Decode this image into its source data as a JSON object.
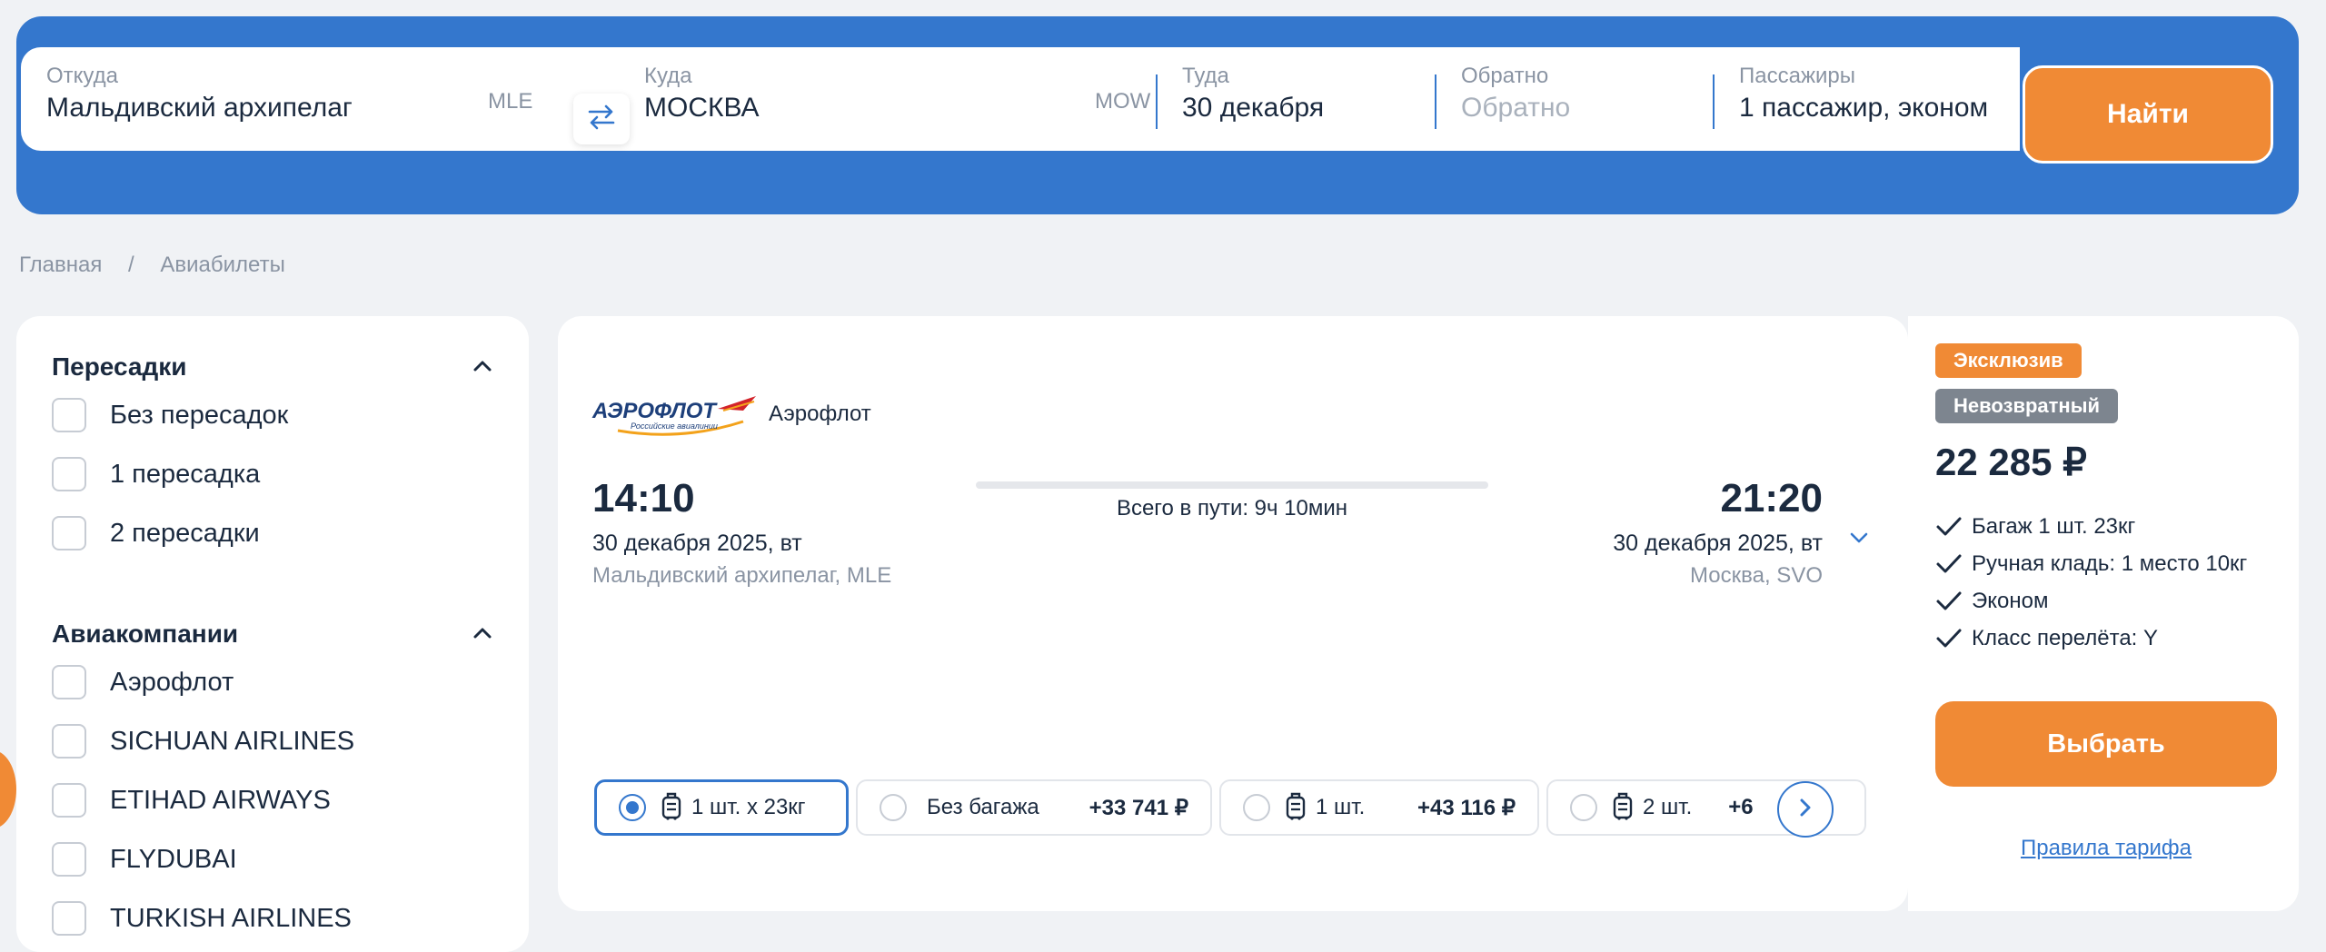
{
  "search": {
    "from_label": "Откуда",
    "from_value": "Мальдивский архипелаг",
    "from_code": "MLE",
    "to_label": "Куда",
    "to_value": "МОСКВА",
    "to_code": "MOW",
    "depart_label": "Туда",
    "depart_value": "30 декабря",
    "return_label": "Обратно",
    "return_placeholder": "Обратно",
    "passengers_label": "Пассажиры",
    "passengers_value": "1 пассажир, эконом",
    "find_button": "Найти",
    "swap_icon": "swap-arrows-icon"
  },
  "breadcrumb": {
    "home": "Главная",
    "separator": "/",
    "current": "Авиабилеты"
  },
  "filters": {
    "transfers_title": "Пересадки",
    "transfers": [
      "Без пересадок",
      "1 пересадка",
      "2 пересадки"
    ],
    "airlines_title": "Авиакомпании",
    "airlines": [
      "Аэрофлот",
      "SICHUAN AIRLINES",
      "ETIHAD AIRWAYS",
      "FLYDUBAI",
      "TURKISH AIRLINES"
    ]
  },
  "flight": {
    "airline_logo_text": "АЭРОФЛОТ",
    "airline_logo_subtext": "Российские авиалинии",
    "airline": "Аэрофлот",
    "depart_time": "14:10",
    "depart_date": "30 декабря 2025, вт",
    "depart_place": "Мальдивский архипелаг, MLE",
    "duration": "Всего в пути: 9ч 10мин",
    "arrive_time": "21:20",
    "arrive_date": "30 декабря 2025, вт",
    "arrive_place": "Москва, SVO",
    "baggage_options": [
      {
        "label": "1 шт. x 23кг",
        "price": "",
        "selected": true
      },
      {
        "label": "Без багажа",
        "price": "+33 741 ₽",
        "selected": false
      },
      {
        "label": "1 шт.",
        "price": "+43 116 ₽",
        "selected": false
      },
      {
        "label": "2 шт.",
        "price": "+6",
        "selected": false
      }
    ]
  },
  "offer": {
    "badge_exclusive": "Эксклюзив",
    "badge_nonrefundable": "Невозвратный",
    "price": "22 285 ₽",
    "features": [
      "Багаж 1 шт. 23кг",
      "Ручная кладь: 1 место 10кг",
      "Эконом",
      "Класс перелёта: Y"
    ],
    "select_button": "Выбрать",
    "rules_link": "Правила тарифа"
  },
  "colors": {
    "primary": "#3477cd",
    "accent": "#f08a35",
    "background": "#f0f2f5"
  }
}
